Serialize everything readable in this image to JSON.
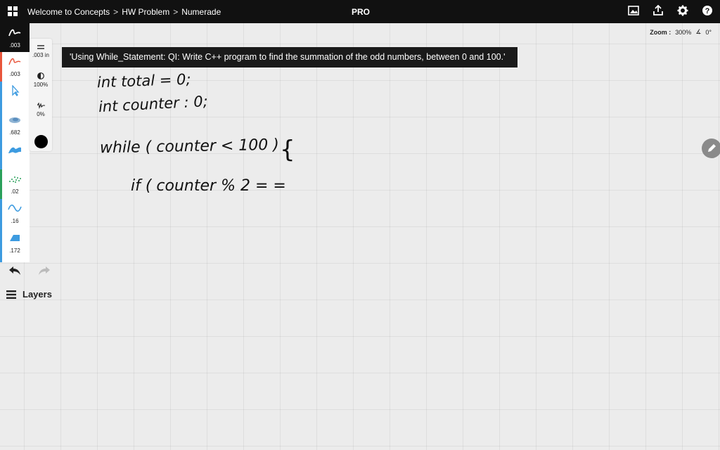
{
  "topbar": {
    "breadcrumbs": [
      "Welcome to Concepts",
      "HW Problem",
      "Numerade"
    ],
    "separator": ">",
    "pro_label": "PRO",
    "icons": [
      "image-icon",
      "export-icon",
      "gear-icon",
      "help-icon"
    ]
  },
  "zoom": {
    "label": "Zoom :",
    "value": "300%",
    "angle": "0°"
  },
  "tools": [
    {
      "name": "pen-tool",
      "value": ".003",
      "color": "#ffffff",
      "active": true
    },
    {
      "name": "pencil-tool",
      "value": ".003",
      "color": "#e8553b"
    },
    {
      "name": "select-tool",
      "value": ""
    },
    {
      "name": "airbrush-tool",
      "value": ".682",
      "color": "#3d9be0"
    },
    {
      "name": "marker-tool",
      "value": "",
      "color": "#3d9be0"
    },
    {
      "name": "stipple-tool",
      "value": ".02",
      "color": "#2aa05a"
    },
    {
      "name": "wave-brush-tool",
      "value": ".16",
      "color": "#3d9be0"
    },
    {
      "name": "eraser-tool",
      "value": ".172",
      "color": "#3d9be0"
    }
  ],
  "settings": {
    "size": ".003 in",
    "opacity": "100%",
    "smoothing": "0%"
  },
  "layers_label": "Layers",
  "banner_text": "'Using While_Statement: QI: Write C++ program to find the summation of the odd numbers, between 0 and 100.'",
  "handwriting": {
    "line1": "int  total = 0;",
    "line2": "int  counter : 0;",
    "line3": "while ( counter < 100 )",
    "brace": "{",
    "line4": "if ( counter % 2 = ="
  }
}
